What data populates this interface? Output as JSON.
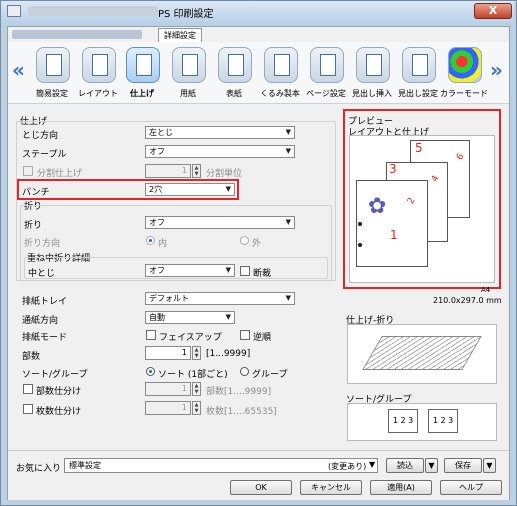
{
  "window": {
    "title": "PS 印刷設定",
    "close_label": "X",
    "tab": "詳細設定"
  },
  "toolbar": {
    "items": [
      {
        "label": "簡易設定",
        "icon": "quick-setup-icon"
      },
      {
        "label": "レイアウト",
        "icon": "layout-icon"
      },
      {
        "label": "仕上げ",
        "icon": "finishing-icon"
      },
      {
        "label": "用紙",
        "icon": "paper-icon"
      },
      {
        "label": "表紙",
        "icon": "cover-icon"
      },
      {
        "label": "くるみ製本",
        "icon": "perfect-binding-icon"
      },
      {
        "label": "ページ設定",
        "icon": "page-setup-icon"
      },
      {
        "label": "見出し挿入",
        "icon": "tab-insert-icon"
      },
      {
        "label": "見出し設定",
        "icon": "tab-setting-icon"
      },
      {
        "label": "カラーモード",
        "icon": "color-mode-icon"
      }
    ],
    "active_index": 2,
    "prev_arrow": "«",
    "next_arrow": "»"
  },
  "finishing": {
    "section_title": "仕上げ",
    "binding_label": "とじ方向",
    "binding_value": "左とじ",
    "staple_label": "ステープル",
    "staple_value": "オフ",
    "split_label": "分割仕上げ",
    "split_value": "1",
    "split_unit": "分割単位",
    "punch_label": "パンチ",
    "punch_value": "2穴"
  },
  "fold": {
    "group_title": "折り",
    "fold_label": "折り",
    "fold_value": "オフ",
    "fold_dir_label": "折り方向",
    "fold_in": "内",
    "fold_out": "外",
    "saddle_group": "重ね中折り詳細",
    "saddle_label": "中とじ",
    "saddle_value": "オフ",
    "trim_label": "断裁"
  },
  "output": {
    "tray_label": "排紙トレイ",
    "tray_value": "デフォルト",
    "feed_label": "通紙方向",
    "feed_value": "自動",
    "mode_label": "排紙モード",
    "face_up_label": "フェイスアップ",
    "reverse_label": "逆順",
    "copies_label": "部数",
    "copies_value": "1",
    "copies_range": "[1...9999]",
    "sort_label": "ソート/グループ",
    "sort_option": "ソート (1部ごと)",
    "group_option": "グループ",
    "set_split_label": "部数仕分け",
    "set_split_value": "1",
    "set_split_range": "部数[1....9999]",
    "sheet_split_label": "枚数仕分け",
    "sheet_split_value": "1",
    "sheet_split_range": "枚数[1....65535]"
  },
  "preview": {
    "title": "プレビュー",
    "subtitle": "レイアウトと仕上げ",
    "paper_name": "A4",
    "paper_size": "210.0x297.0 mm",
    "page_numbers": [
      "1",
      "2",
      "3",
      "4",
      "5",
      "6"
    ],
    "finish_fold_title": "仕上げ-折り",
    "sort_group_title": "ソート/グループ",
    "accent_color": "#e0262d"
  },
  "footer": {
    "favorites_label": "お気に入り",
    "favorites_value": "標準設定",
    "changed_note": "(変更あり)",
    "load_label": "読込",
    "save_label": "保存",
    "ok_label": "OK",
    "cancel_label": "キャンセル",
    "apply_label": "適用(A)",
    "help_label": "ヘルプ"
  }
}
